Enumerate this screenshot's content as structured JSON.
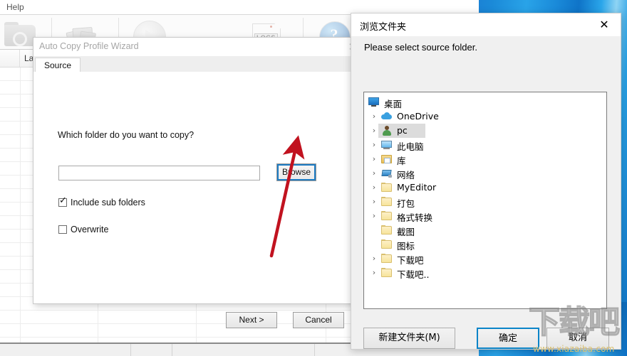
{
  "background_app": {
    "menu": {
      "help_label": "Help"
    },
    "toolbar": {
      "icons": [
        {
          "name": "open-folder-icon"
        },
        {
          "name": "copy-files-icon"
        },
        {
          "name": "run-icon"
        },
        {
          "name": "logs-icon",
          "label": "LOGS"
        },
        {
          "name": "help-icon"
        }
      ]
    },
    "grid": {
      "columns": [
        {
          "label": ""
        },
        {
          "label": "Last "
        },
        {
          "label": ""
        },
        {
          "label": ""
        },
        {
          "label": ""
        }
      ]
    }
  },
  "wizard": {
    "title": "Auto Copy Profile Wizard",
    "close_label": "✕",
    "tabs": [
      {
        "label": "Source"
      }
    ],
    "question": "Which folder do you want to copy?",
    "source_path": "",
    "source_placeholder": "",
    "browse_label": "Browse",
    "checkboxes": [
      {
        "label": "Include sub folders",
        "checked": true,
        "mark": "✓"
      },
      {
        "label": "Overwrite",
        "checked": false,
        "mark": ""
      }
    ],
    "buttons": [
      {
        "label": "Next >",
        "name": "next-button"
      },
      {
        "label": "Cancel",
        "name": "cancel-button"
      }
    ]
  },
  "browse_dialog": {
    "title": "浏览文件夹",
    "close_label": "✕",
    "prompt": "Please select source folder.",
    "tree": [
      {
        "label": "桌面",
        "icon": "monitor-icon",
        "indent": 0,
        "chevron": "",
        "selected": false
      },
      {
        "label": "OneDrive",
        "icon": "cloud-icon",
        "indent": 1,
        "chevron": "›",
        "selected": false
      },
      {
        "label": "pc",
        "icon": "user-icon",
        "indent": 1,
        "chevron": "›",
        "selected": true
      },
      {
        "label": "此电脑",
        "icon": "computer-icon",
        "indent": 1,
        "chevron": "›",
        "selected": false
      },
      {
        "label": "库",
        "icon": "library-icon",
        "indent": 1,
        "chevron": "›",
        "selected": false
      },
      {
        "label": "网络",
        "icon": "network-icon",
        "indent": 1,
        "chevron": "›",
        "selected": false
      },
      {
        "label": "MyEditor",
        "icon": "folder-icon",
        "indent": 1,
        "chevron": "›",
        "selected": false
      },
      {
        "label": "打包",
        "icon": "folder-icon",
        "indent": 1,
        "chevron": "›",
        "selected": false
      },
      {
        "label": "格式转换",
        "icon": "folder-icon",
        "indent": 1,
        "chevron": "›",
        "selected": false
      },
      {
        "label": "截图",
        "icon": "folder-icon",
        "indent": 1,
        "chevron": "",
        "selected": false
      },
      {
        "label": "图标",
        "icon": "folder-icon",
        "indent": 1,
        "chevron": "",
        "selected": false
      },
      {
        "label": "下载吧",
        "icon": "folder-icon",
        "indent": 1,
        "chevron": "›",
        "selected": false
      },
      {
        "label": "下载吧..",
        "icon": "folder-icon",
        "indent": 1,
        "chevron": "›",
        "selected": false
      }
    ],
    "buttons": [
      {
        "label": "新建文件夹(M)",
        "name": "new-folder-button",
        "focused": false
      },
      {
        "label": "确定",
        "name": "ok-button",
        "focused": true
      },
      {
        "label": "取消",
        "name": "cancel-button",
        "focused": false
      }
    ]
  },
  "annotation": {
    "arrow_color": "#c1121f"
  },
  "watermark": {
    "text": "下载吧",
    "url": "www.xiazaiba.com"
  }
}
